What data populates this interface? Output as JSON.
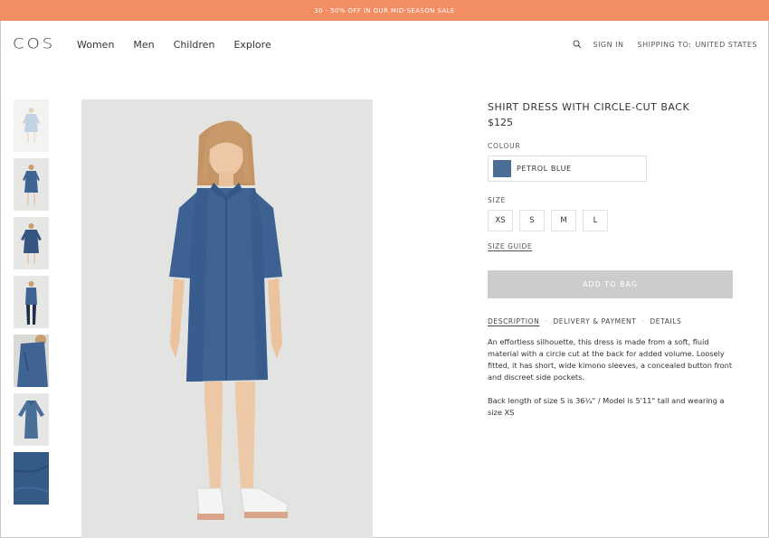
{
  "promo": {
    "text": "30 - 50% OFF IN OUR MID-SEASON SALE"
  },
  "header": {
    "logo": "COS",
    "nav": [
      "Women",
      "Men",
      "Children",
      "Explore"
    ],
    "sign_in": "SIGN IN",
    "shipping_label": "SHIPPING TO:",
    "shipping_country": "UNITED STATES"
  },
  "product": {
    "title": "SHIRT DRESS WITH CIRCLE-CUT BACK",
    "price": "$125",
    "colour_label": "COLOUR",
    "colour_name": "PETROL BLUE",
    "size_label": "SIZE",
    "sizes": [
      "XS",
      "S",
      "M",
      "L"
    ],
    "size_guide": "SIZE GUIDE",
    "add_to_bag": "ADD TO BAG",
    "tabs": [
      "DESCRIPTION",
      "DELIVERY & PAYMENT",
      "DETAILS"
    ],
    "description": "An effortless silhouette, this dress is made from a soft, fluid material with a circle cut at the back for added volume. Loosely fitted, it has short, wide kimono sleeves, a concealed button front and discreet side pockets.",
    "measurements": "Back length of size S is 36¼\" / Model is 5'11\" tall and wearing a size XS"
  },
  "colors": {
    "promo_bg": "#f28d64",
    "swatch": "#4b6e96",
    "dress": "#3f6494",
    "button_bg": "#cccccc"
  }
}
